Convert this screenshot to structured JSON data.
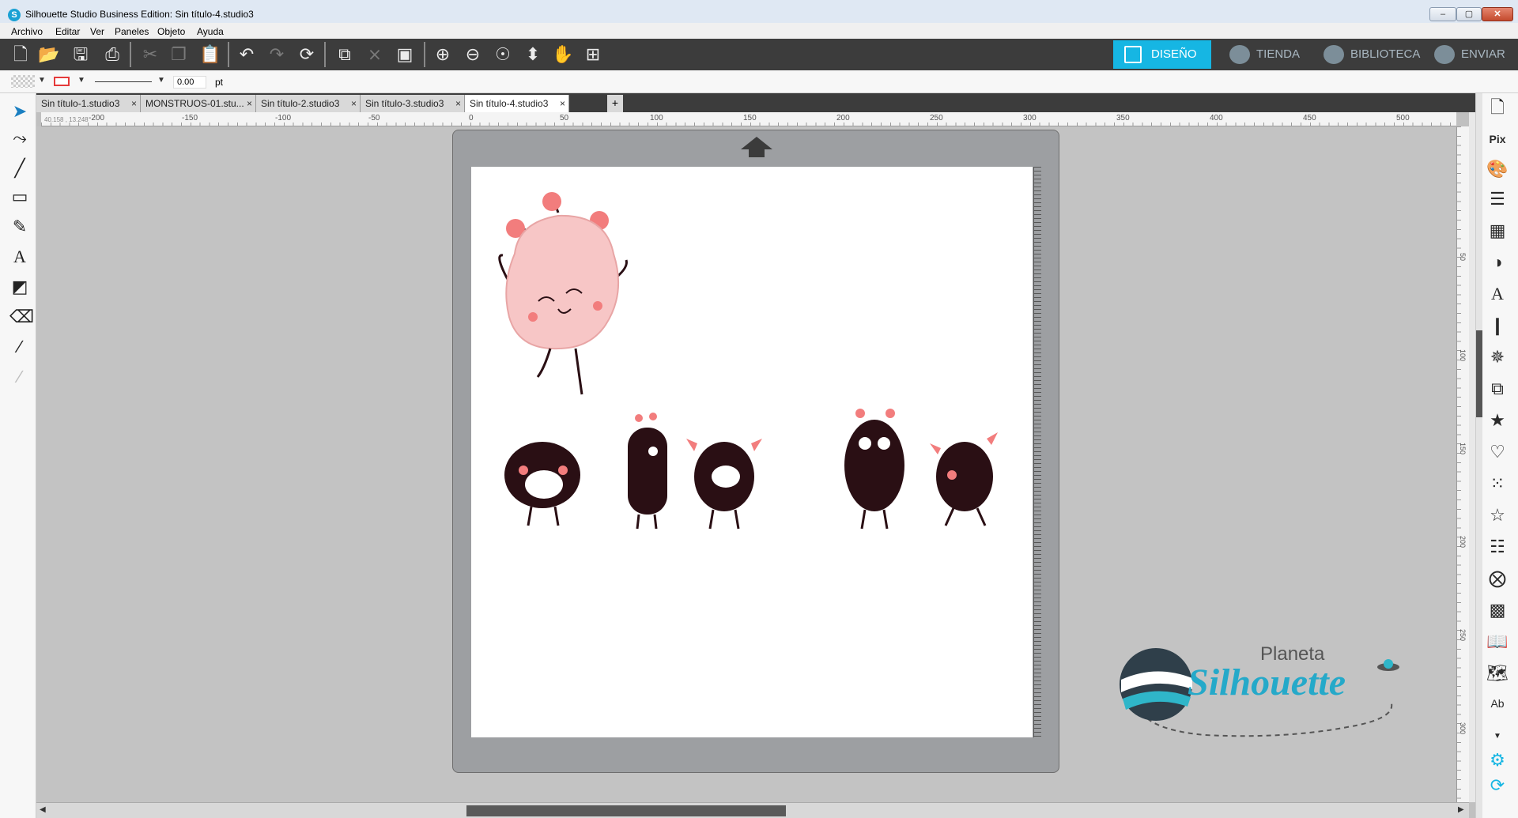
{
  "window": {
    "title": "Silhouette Studio Business Edition: Sin título-4.studio3",
    "controls": {
      "minimize": "–",
      "maximize": "▢",
      "close": "✕"
    }
  },
  "menu": [
    "Archivo",
    "Editar",
    "Ver",
    "Paneles",
    "Objeto",
    "Ayuda"
  ],
  "toolbar": {
    "icons": [
      "new-document-icon",
      "open-folder-icon",
      "save-icon",
      "print-icon",
      "cut-icon",
      "copy-icon",
      "paste-icon",
      "undo-icon",
      "redo-icon",
      "refresh-icon",
      "group-icon",
      "ungroup-icon",
      "trace-icon",
      "zoom-in-icon",
      "zoom-out-icon",
      "zoom-fit-icon",
      "move-down-icon",
      "pan-hand-icon",
      "add-page-icon"
    ],
    "nav": {
      "diseno": "DISEÑO",
      "tienda": "TIENDA",
      "biblioteca": "BIBLIOTECA",
      "enviar": "ENVIAR"
    },
    "accent_color": "#16b6e3"
  },
  "properties": {
    "stroke_width": "0.00",
    "stroke_unit": "pt",
    "line_color": "#e53a3a"
  },
  "tabs": [
    {
      "label": "Sin título-1.studio3",
      "active": false
    },
    {
      "label": "MONSTRUOS-01.stu...",
      "active": false
    },
    {
      "label": "Sin título-2.studio3",
      "active": false
    },
    {
      "label": "Sin título-3.studio3",
      "active": false
    },
    {
      "label": "Sin título-4.studio3",
      "active": true
    }
  ],
  "tab_add": "+",
  "tab_close": "×",
  "ruler": {
    "coordinate": "40.158 , 13.248",
    "h_labels": [
      "-200",
      "-150",
      "-100",
      "-50",
      "0",
      "50",
      "100",
      "150",
      "200",
      "250",
      "300",
      "350",
      "400",
      "450",
      "500"
    ],
    "v_labels": [
      "50",
      "100",
      "150",
      "200",
      "250",
      "300"
    ]
  },
  "watermark": {
    "line1": "Planeta",
    "line2": "Silhouette"
  },
  "colors": {
    "monster_pink": "#f7c6c6",
    "monster_dot": "#f27d7d",
    "monster_dark": "#2a0f14"
  }
}
